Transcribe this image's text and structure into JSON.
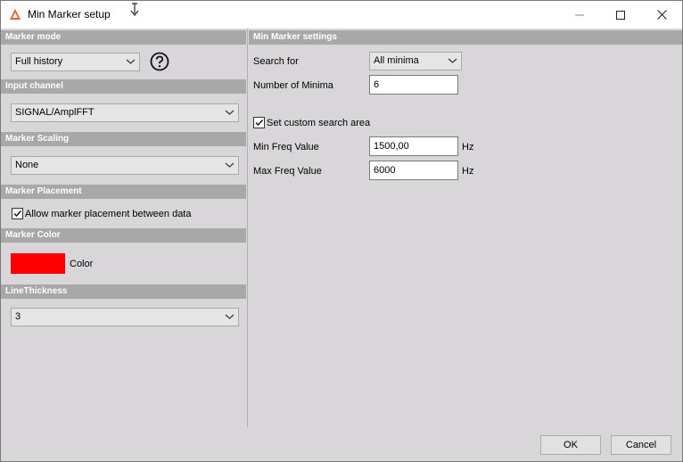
{
  "window": {
    "title": "Min Marker setup",
    "accent": "#e8602c"
  },
  "left": {
    "marker_mode": {
      "header": "Marker mode",
      "value": "Full history"
    },
    "input_channel": {
      "header": "Input channel",
      "value": "SIGNAL/AmplFFT"
    },
    "marker_scaling": {
      "header": "Marker Scaling",
      "value": "None"
    },
    "marker_placement": {
      "header": "Marker Placement",
      "checkbox_label": "Allow marker placement between data",
      "checked": true
    },
    "marker_color": {
      "header": "Marker Color",
      "color": "#ff0000",
      "label": "Color"
    },
    "line_thickness": {
      "header": "LineThickness",
      "value": "3"
    }
  },
  "right": {
    "header": "Min Marker settings",
    "search_for_label": "Search for",
    "search_for_value": "All minima",
    "num_minima_label": "Number of Minima",
    "num_minima_value": "6",
    "custom_area_label": "Set custom search area",
    "custom_area_checked": true,
    "min_freq_label": "Min Freq Value",
    "min_freq_value": "1500,00",
    "min_freq_unit": "Hz",
    "max_freq_label": "Max Freq Value",
    "max_freq_value": "6000",
    "max_freq_unit": "Hz"
  },
  "buttons": {
    "ok": "OK",
    "cancel": "Cancel"
  }
}
